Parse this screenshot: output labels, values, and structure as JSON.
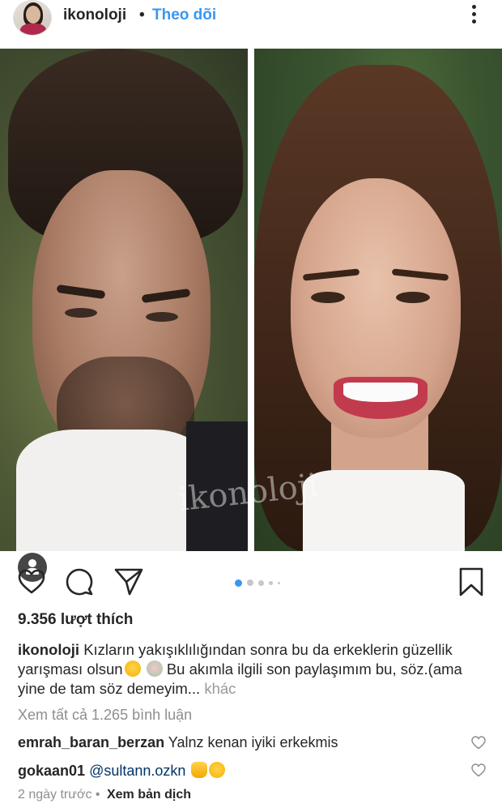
{
  "header": {
    "username": "ikonoloji",
    "separator": "•",
    "follow_label": "Theo dõi",
    "more_icon": "more-vertical-icon"
  },
  "post": {
    "watermark": "ikonoloji",
    "carousel": {
      "total": 4,
      "active_index": 0
    },
    "tag_icon": "user-tag-icon"
  },
  "actions": {
    "like_icon": "heart-icon",
    "comment_icon": "comment-icon",
    "share_icon": "paper-plane-icon",
    "save_icon": "bookmark-icon"
  },
  "likes": "9.356 lượt thích",
  "caption": {
    "username": "ikonoloji",
    "text_part1": "Kızların yakışıklılığından sonra bu da erkeklerin güzellik yarışması olsun",
    "text_part2": " Bu akımla ilgili son paylaşımım bu, söz.(ama yine de tam söz demeyim...",
    "more_label": "khác"
  },
  "view_all_comments": "Xem tất cả 1.265 bình luận",
  "comments": [
    {
      "username": "emrah_baran_berzan",
      "text": "Yalnz kenan iyiki erkekmis"
    },
    {
      "username": "gokaan01",
      "mention": "@sultann.ozkn",
      "text": ""
    }
  ],
  "meta": {
    "time_ago": "2 ngày trước",
    "separator": "•",
    "translate_label": "Xem bản dịch"
  },
  "colors": {
    "link_blue": "#3897f0",
    "text": "#262626",
    "muted": "#8e8e8e",
    "carousel_active": "#3897f0"
  }
}
